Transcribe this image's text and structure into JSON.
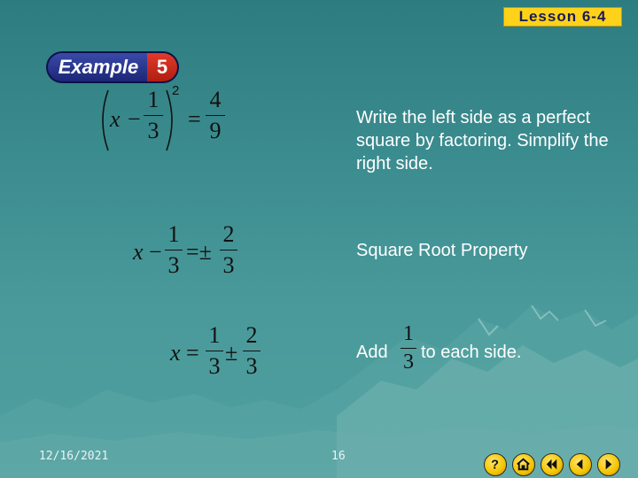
{
  "header": {
    "lesson_label": "Lesson 6-4"
  },
  "example": {
    "word": "Example",
    "number": "5"
  },
  "steps": [
    {
      "note": "Write the left side as a perfect square by factoring. Simplify the right side.",
      "math": {
        "var": "x",
        "op1": "−",
        "n1": "1",
        "d1": "3",
        "exp": "2",
        "eq": "=",
        "n2": "4",
        "d2": "9"
      }
    },
    {
      "note": "Square Root Property",
      "math": {
        "var": "x",
        "op1": "−",
        "n1": "1",
        "d1": "3",
        "eq": "=±",
        "n2": "2",
        "d2": "3"
      }
    },
    {
      "note_before": "Add",
      "note_after": "to each side.",
      "note_frac": {
        "n": "1",
        "d": "3"
      },
      "math": {
        "var": "x",
        "eq": "=",
        "n1": "1",
        "d1": "3",
        "pm": "±",
        "n2": "2",
        "d2": "3"
      }
    }
  ],
  "footer": {
    "date": "12/16/2021",
    "page": "16"
  },
  "nav": [
    {
      "icon": "help-icon"
    },
    {
      "icon": "home-icon"
    },
    {
      "icon": "first-slide-icon"
    },
    {
      "icon": "previous-slide-icon"
    },
    {
      "icon": "next-slide-icon"
    }
  ],
  "colors": {
    "background": "#3c8d90",
    "accent": "#ffd21a",
    "badge_blue": "#1c2677",
    "badge_red": "#c52a1a"
  }
}
